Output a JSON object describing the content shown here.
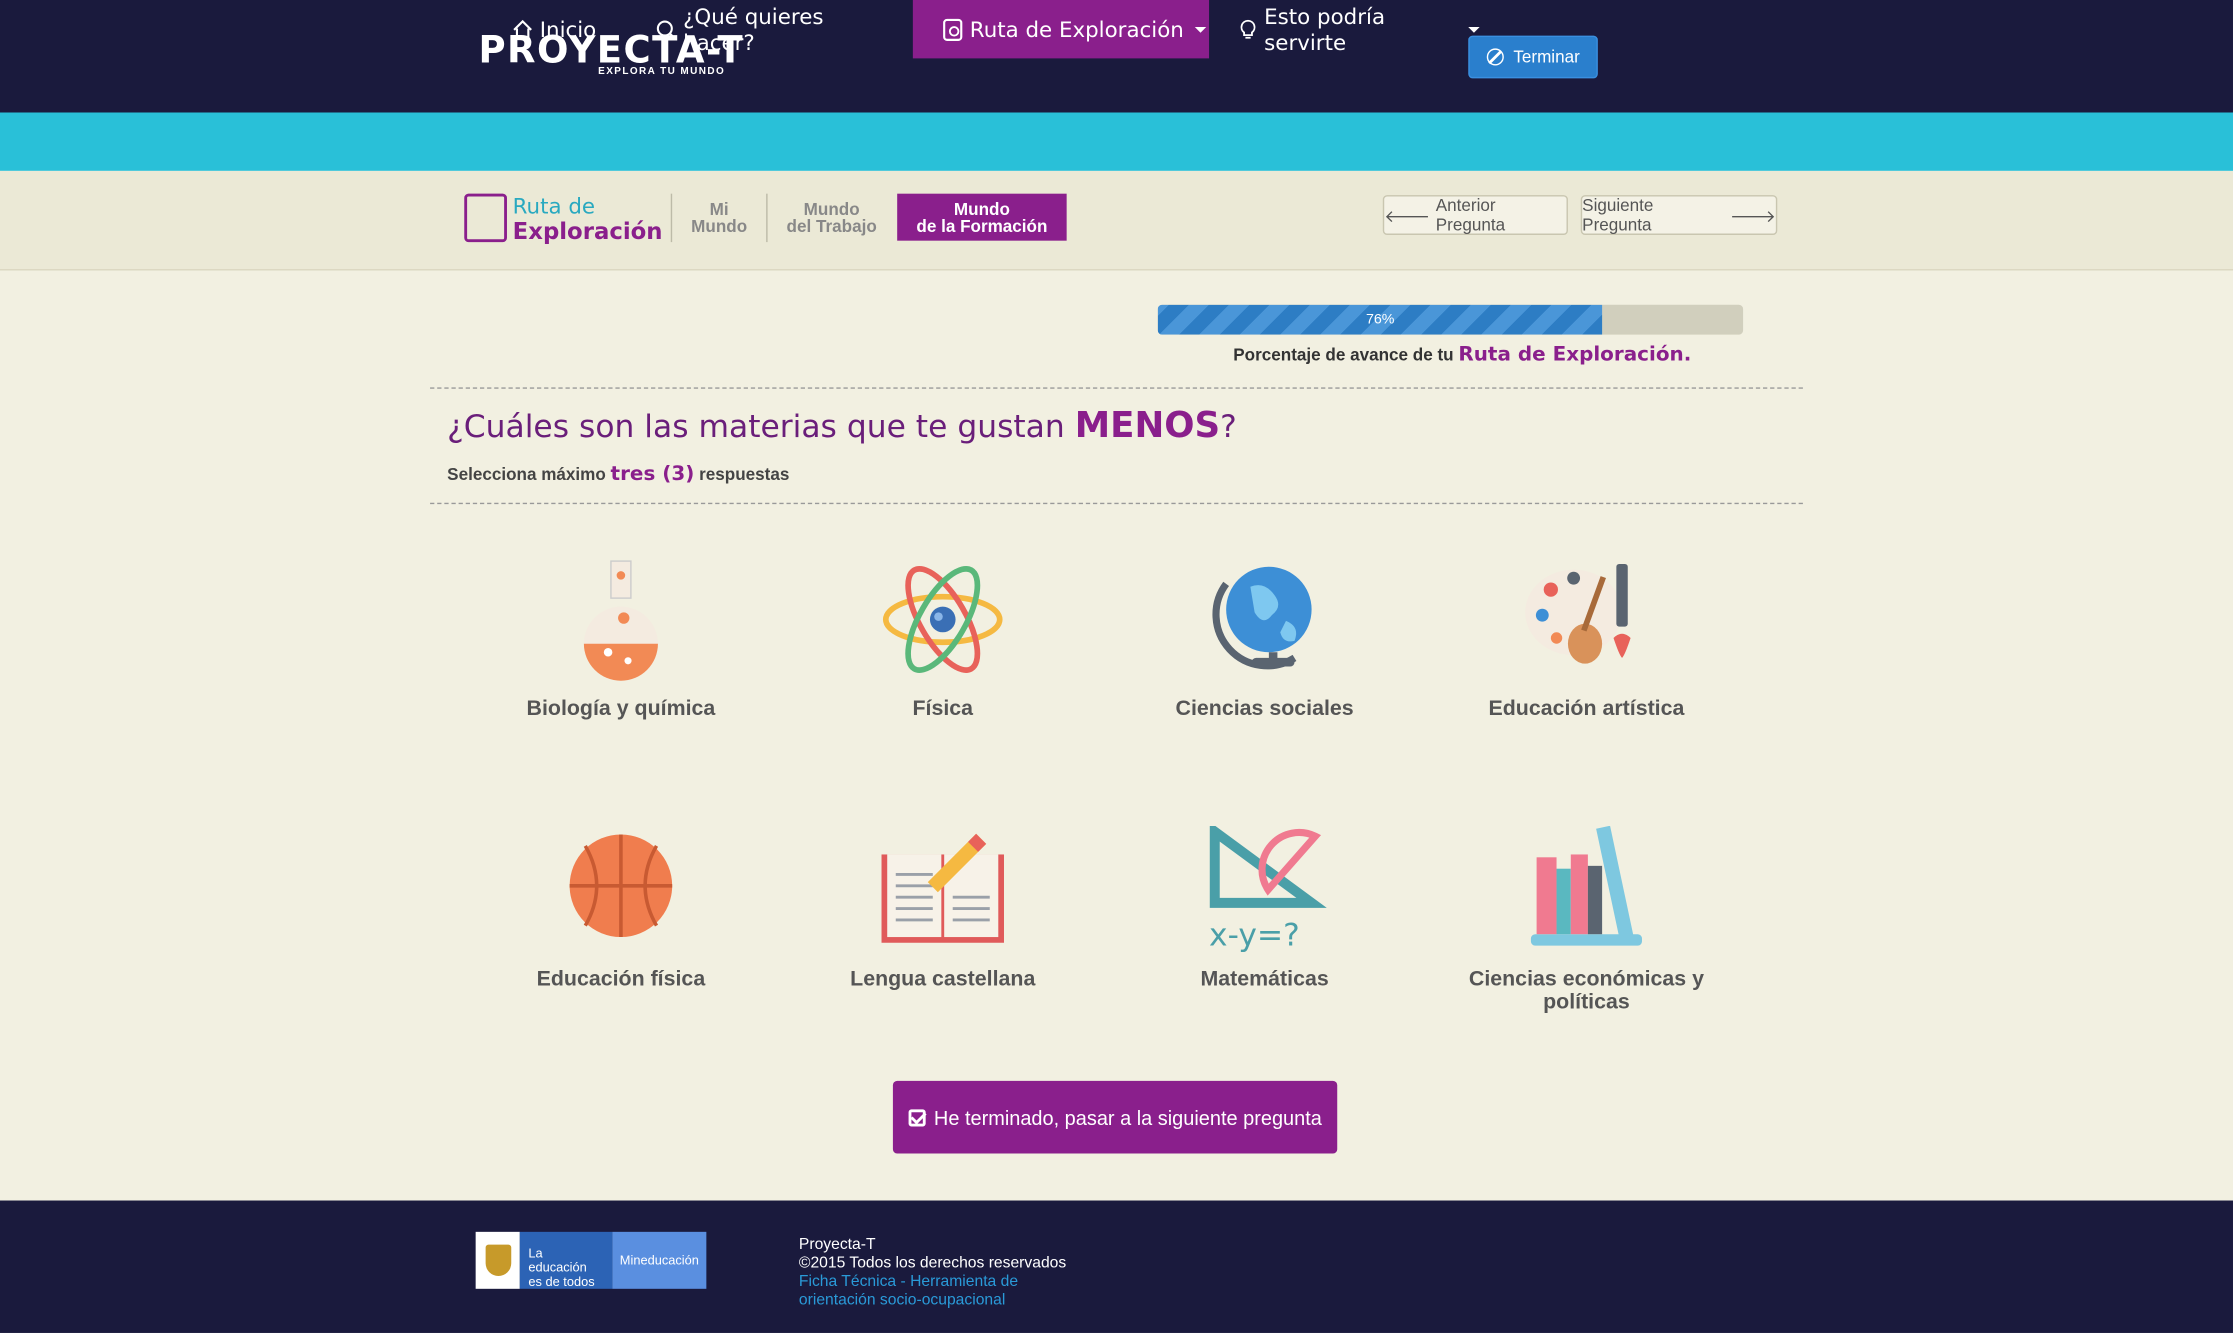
{
  "header": {
    "logo_text": "PROYECTA-T",
    "logo_tagline": "EXPLORA TU MUNDO",
    "terminar_label": "Terminar"
  },
  "nav": {
    "items": [
      {
        "label": "Inicio",
        "icon": "home-icon"
      },
      {
        "label": "¿Qué quieres hacer?",
        "icon": "search-icon"
      },
      {
        "label": "Ruta de Exploración",
        "icon": "route-icon",
        "dropdown": true,
        "active": true
      },
      {
        "label": "Esto podría servirte",
        "icon": "lightbulb-icon",
        "dropdown": true
      }
    ]
  },
  "subnav": {
    "ruta_line1": "Ruta de",
    "ruta_line2": "Exploración",
    "steps": [
      {
        "line1": "Mi",
        "line2": "Mundo"
      },
      {
        "line1": "Mundo",
        "line2": "del Trabajo"
      },
      {
        "line1": "Mundo",
        "line2": "de la Formación",
        "current": true
      }
    ],
    "prev_label": "Anterior Pregunta",
    "next_label": "Siguiente Pregunta"
  },
  "progress": {
    "value": 0.76,
    "label": "76%",
    "caption_prefix": "Porcentaje de avance de tu",
    "caption_highlight": "Ruta de Exploración."
  },
  "question": {
    "title_prefix": "¿Cuáles son las materias que te gustan",
    "title_emphasis": "MENOS",
    "title_suffix": "?",
    "sub_prefix": "Selecciona máximo",
    "sub_highlight": "tres (3)",
    "sub_suffix": "respuestas"
  },
  "options": [
    {
      "label": "Biología y química",
      "icon": "flask-icon"
    },
    {
      "label": "Física",
      "icon": "atom-icon"
    },
    {
      "label": "Ciencias sociales",
      "icon": "globe-icon"
    },
    {
      "label": "Educación artística",
      "icon": "art-palette-icon"
    },
    {
      "label": "Educación física",
      "icon": "basketball-icon"
    },
    {
      "label": "Lengua castellana",
      "icon": "book-pencil-icon"
    },
    {
      "label": "Matemáticas",
      "icon": "ruler-protractor-icon"
    },
    {
      "label": "Ciencias económicas y políticas",
      "icon": "books-icon"
    }
  ],
  "math_formula": "x-y=?",
  "finish_label": "He terminado, pasar a la siguiente pregunta",
  "footer": {
    "edu_text": "La educación es de todos",
    "min_text": "Mineducación",
    "line1": "Proyecta-T",
    "line2": "©2015 Todos los derechos reservados",
    "link": "Ficha Técnica - Herramienta de orientación socio-ocupacional"
  },
  "colors": {
    "brand_purple": "#8a1f8c",
    "nav_cyan": "#29c0d8",
    "header_navy": "#1a1a3d",
    "primary_blue": "#2a7fcd",
    "background": "#f2f0e1"
  }
}
